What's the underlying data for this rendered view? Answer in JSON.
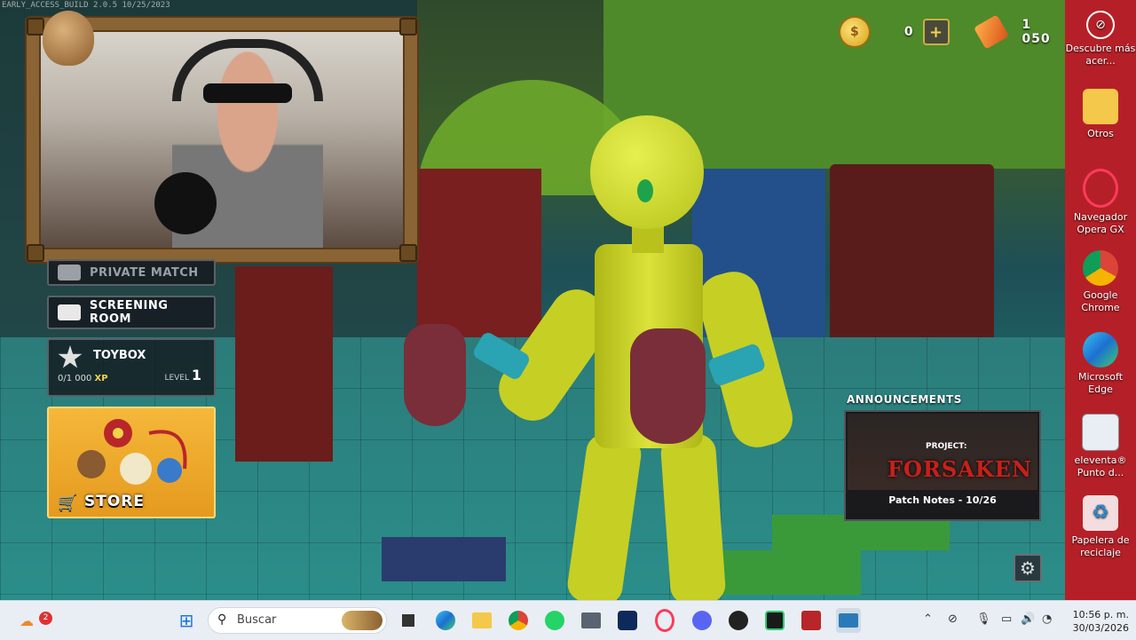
{
  "build_label": "EARLY_ACCESS_BUILD 2.0.5 10/25/2023",
  "hud": {
    "coin_icon": "coin-icon",
    "coin_value": "0",
    "ticket_icon": "ticket-icon",
    "ticket_value": "1 050"
  },
  "menu": {
    "private_match": "PRIVATE MATCH",
    "screening_room": "SCREENING ROOM",
    "toybox": {
      "label": "TOYBOX",
      "xp_value": "0/1 000",
      "xp_unit": "XP",
      "level_label": "LEVEL",
      "level_value": "1"
    },
    "store": "STORE"
  },
  "announcements": {
    "title": "ANNOUNCEMENTS",
    "project_label": "PROJECT:",
    "project_name": "FORSAKEN",
    "patch_notes": "Patch Notes - 10/26"
  },
  "desktop_icons": [
    {
      "label": "Descubre más acer...",
      "icon": "acer-icon"
    },
    {
      "label": "Otros",
      "icon": "folder-icon"
    },
    {
      "label": "Navegador Opera GX",
      "icon": "opera-gx-icon"
    },
    {
      "label": "Google Chrome",
      "icon": "chrome-icon"
    },
    {
      "label": "Microsoft Edge",
      "icon": "edge-icon"
    },
    {
      "label": "eleventa® Punto d...",
      "icon": "eleventa-icon"
    },
    {
      "label": "Papelera de reciclaje",
      "icon": "recycle-bin-icon"
    }
  ],
  "taskbar": {
    "weather_badge": "2",
    "search_placeholder": "Buscar",
    "time": "10:56 p. m.",
    "date": "30/03/2026"
  },
  "colors": {
    "desktop_bg": "#b52028",
    "store_bg": "#f5b83a",
    "robot_yellow": "#c6cf24",
    "taskbar_bg": "#e9eef4"
  }
}
